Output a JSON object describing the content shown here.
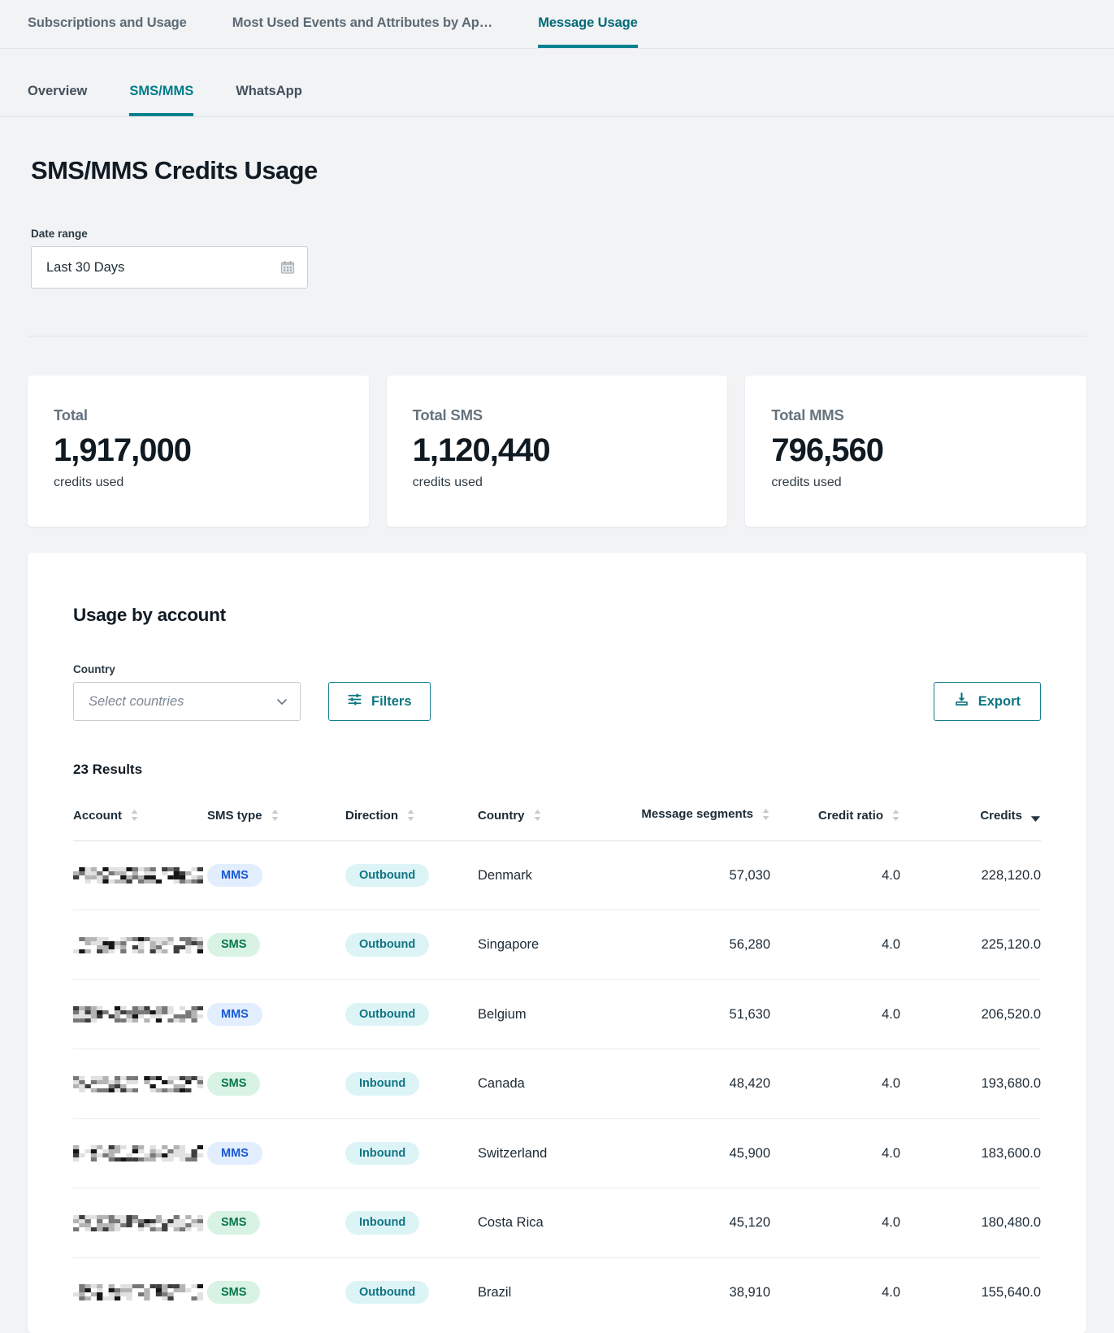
{
  "top_tabs": [
    {
      "label": "Subscriptions and Usage",
      "active": false
    },
    {
      "label": "Most Used Events and Attributes by Ap…",
      "active": false
    },
    {
      "label": "Message Usage",
      "active": true
    }
  ],
  "sub_tabs": [
    {
      "label": "Overview",
      "active": false
    },
    {
      "label": "SMS/MMS",
      "active": true
    },
    {
      "label": "WhatsApp",
      "active": false
    }
  ],
  "page": {
    "title": "SMS/MMS Credits Usage",
    "date_range_label": "Date range",
    "date_range_value": "Last 30 Days",
    "calendar_icon": "calendar-icon"
  },
  "stats": [
    {
      "label": "Total",
      "value": "1,917,000",
      "unit": "credits used"
    },
    {
      "label": "Total SMS",
      "value": "1,120,440",
      "unit": "credits used"
    },
    {
      "label": "Total MMS",
      "value": "796,560",
      "unit": "credits used"
    }
  ],
  "usage": {
    "title": "Usage by account",
    "country_label": "Country",
    "country_placeholder": "Select countries",
    "filters_label": "Filters",
    "filters_icon": "sliders-icon",
    "export_label": "Export",
    "export_icon": "download-icon",
    "chevron_icon": "chevron-down-icon",
    "results_label": "23 Results"
  },
  "table": {
    "columns": [
      {
        "label": "Account",
        "align": "left",
        "sort": "none"
      },
      {
        "label": "SMS type",
        "align": "left",
        "sort": "none"
      },
      {
        "label": "Direction",
        "align": "left",
        "sort": "none"
      },
      {
        "label": "Country",
        "align": "left",
        "sort": "none"
      },
      {
        "label": "Message segments",
        "align": "right",
        "sort": "none"
      },
      {
        "label": "Credit ratio",
        "align": "right",
        "sort": "none"
      },
      {
        "label": "Credits",
        "align": "right",
        "sort": "desc"
      }
    ],
    "rows": [
      {
        "account": "",
        "redacted": true,
        "sms_type": "MMS",
        "direction": "Outbound",
        "country": "Denmark",
        "segments": "57,030",
        "ratio": "4.0",
        "credits": "228,120.0"
      },
      {
        "account": "",
        "redacted": true,
        "sms_type": "SMS",
        "direction": "Outbound",
        "country": "Singapore",
        "segments": "56,280",
        "ratio": "4.0",
        "credits": "225,120.0"
      },
      {
        "account": "",
        "redacted": true,
        "sms_type": "MMS",
        "direction": "Outbound",
        "country": "Belgium",
        "segments": "51,630",
        "ratio": "4.0",
        "credits": "206,520.0"
      },
      {
        "account": "",
        "redacted": true,
        "sms_type": "SMS",
        "direction": "Inbound",
        "country": "Canada",
        "segments": "48,420",
        "ratio": "4.0",
        "credits": "193,680.0"
      },
      {
        "account": "",
        "redacted": true,
        "sms_type": "MMS",
        "direction": "Inbound",
        "country": "Switzerland",
        "segments": "45,900",
        "ratio": "4.0",
        "credits": "183,600.0"
      },
      {
        "account": "",
        "redacted": true,
        "sms_type": "SMS",
        "direction": "Inbound",
        "country": "Costa Rica",
        "segments": "45,120",
        "ratio": "4.0",
        "credits": "180,480.0"
      },
      {
        "account": "",
        "redacted": true,
        "sms_type": "SMS",
        "direction": "Outbound",
        "country": "Brazil",
        "segments": "38,910",
        "ratio": "4.0",
        "credits": "155,640.0"
      }
    ]
  },
  "colors": {
    "accent_teal": "#00818e",
    "page_bg": "#f2f3f5",
    "card_bg": "#ffffff",
    "badge_mms_bg": "#e2edfd",
    "badge_mms_fg": "#1558d6",
    "badge_sms_bg": "#d8f2e4",
    "badge_sms_fg": "#07764a",
    "badge_dir_bg": "#ddf4f7",
    "badge_dir_fg": "#0f7582"
  }
}
